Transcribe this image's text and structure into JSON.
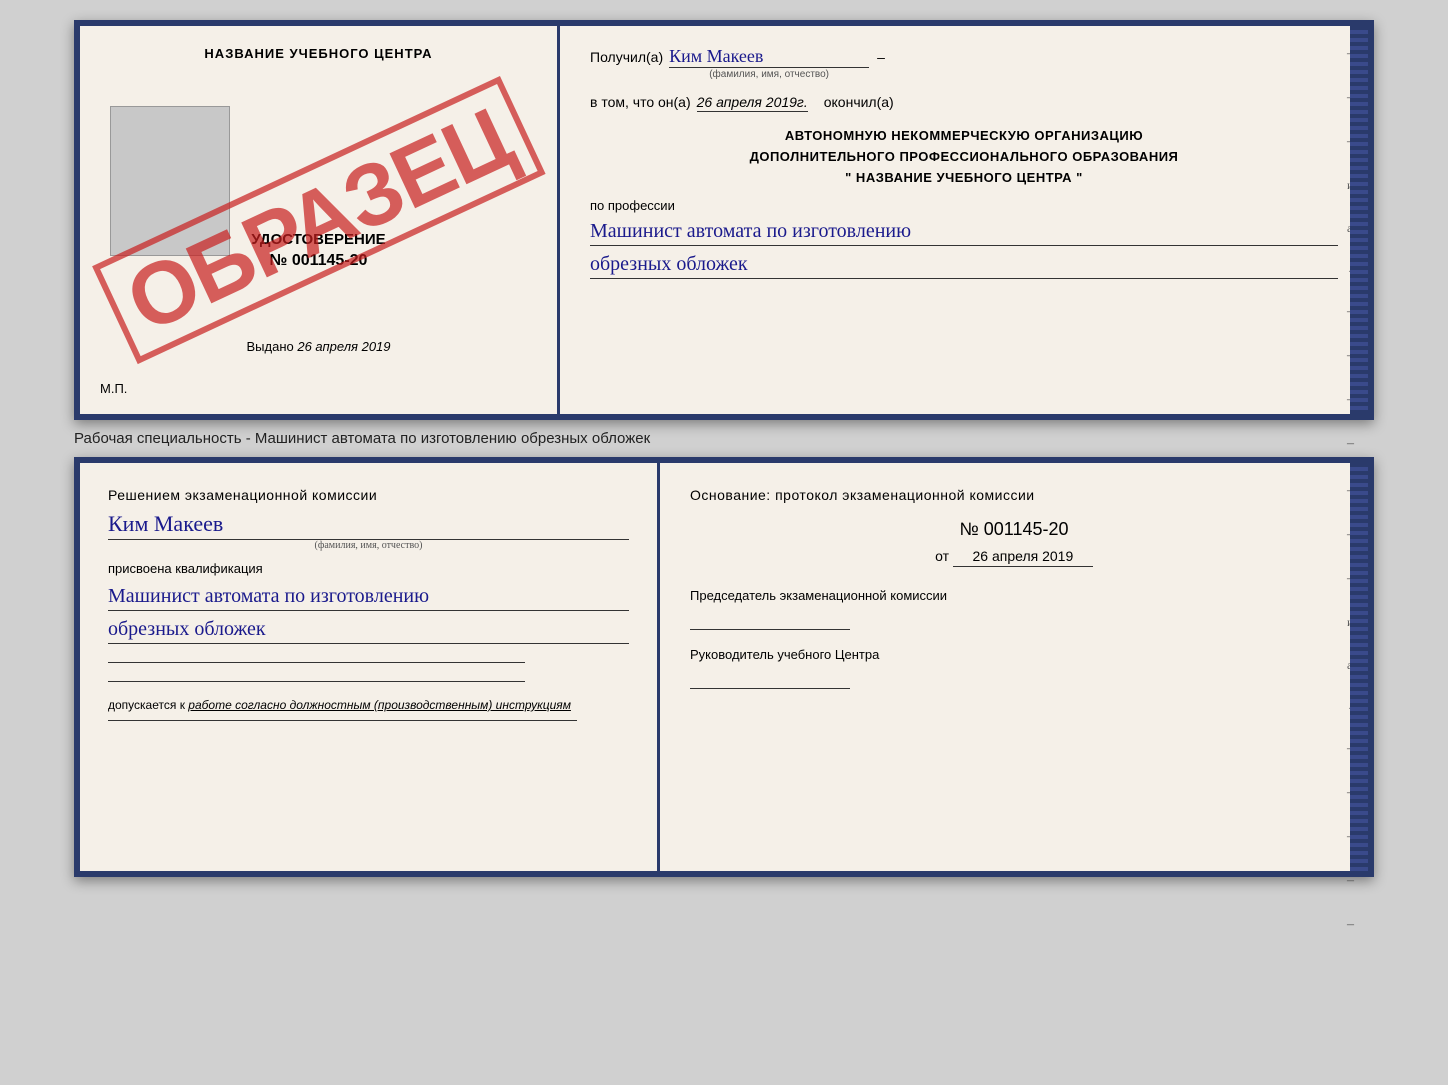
{
  "top_cert": {
    "left": {
      "title": "НАЗВАНИЕ УЧЕБНОГО ЦЕНТРА",
      "watermark": "ОБРАЗЕЦ",
      "subtitle": "УДОСТОВЕРЕНИЕ",
      "number": "№ 001145-20",
      "issued_label": "Выдано",
      "issued_date": "26 апреля 2019",
      "mp_label": "М.П."
    },
    "right": {
      "received_label": "Получил(а)",
      "recipient_name": "Ким Макеев",
      "fio_subtext": "(фамилия, имя, отчество)",
      "date_label": "в том, что он(а)",
      "date_value": "26 апреля 2019г.",
      "finished_label": "окончил(а)",
      "org_line1": "АВТОНОМНУЮ НЕКОММЕРЧЕСКУЮ ОРГАНИЗАЦИЮ",
      "org_line2": "ДОПОЛНИТЕЛЬНОГО ПРОФЕССИОНАЛЬНОГО ОБРАЗОВАНИЯ",
      "org_line3": "\"  НАЗВАНИЕ УЧЕБНОГО ЦЕНТРА  \"",
      "profession_label": "по профессии",
      "profession_line1": "Машинист автомата по изготовлению",
      "profession_line2": "обрезных обложек"
    }
  },
  "separator": {
    "text": "Рабочая специальность - Машинист автомата по изготовлению обрезных обложек"
  },
  "bottom_cert": {
    "left": {
      "title": "Решением экзаменационной комиссии",
      "name": "Ким Макеев",
      "fio_subtext": "(фамилия, имя, отчество)",
      "prisvoena_label": "присвоена квалификация",
      "profession_line1": "Машинист автомата по изготовлению",
      "profession_line2": "обрезных обложек",
      "dopuskaetsya_label": "допускается к",
      "dopuskaetsya_text": "работе согласно должностным (производственным) инструкциям"
    },
    "right": {
      "osnov_label": "Основание: протокол экзаменационной комиссии",
      "number": "№  001145-20",
      "date_prefix": "от",
      "date_value": "26 апреля 2019",
      "chairman_label": "Председатель экзаменационной комиссии",
      "head_label": "Руководитель учебного Центра"
    }
  }
}
